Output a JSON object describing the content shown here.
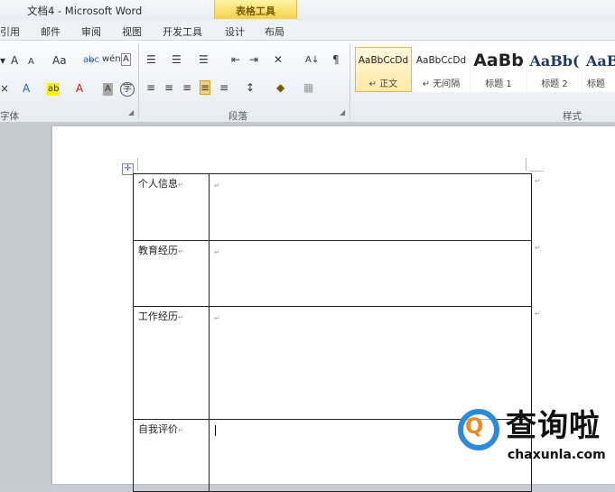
{
  "window": {
    "title": "文档4 - Microsoft Word"
  },
  "contextual_tab": {
    "label": "表格工具"
  },
  "tabs": [
    "引用",
    "邮件",
    "审阅",
    "视图",
    "开发工具",
    "设计",
    "布局"
  ],
  "ribbon": {
    "groups": {
      "font": "字体",
      "paragraph": "段落",
      "styles": "样式"
    },
    "font_tools": {
      "grow": "A",
      "shrink": "A",
      "change_case": "Aa",
      "clear_format": "ab̶c",
      "phonetic": "wén",
      "char_border": "A",
      "clear": "×",
      "text_effect": "A",
      "highlight": "ab",
      "font_color": "A",
      "char_shading": "A",
      "enclose": "字"
    },
    "paragraph_tools": {
      "bullets": "☰",
      "numbering": "☰",
      "multilevel": "☰",
      "dec_indent": "⇤",
      "inc_indent": "⇥",
      "chinese_layout": "✕",
      "sort": "A↓",
      "show_marks": "¶",
      "align_left": "≡",
      "center": "≡",
      "align_right": "≡",
      "justify": "≡",
      "distributed": "≡",
      "line_spacing": "↕",
      "shading": "◆",
      "borders": "▦"
    },
    "styles": [
      {
        "preview": "AaBbCcDd",
        "name": "↵ 正文"
      },
      {
        "preview": "AaBbCcDd",
        "name": "↵ 无间隔"
      },
      {
        "preview": "AaBb",
        "name": "标题 1"
      },
      {
        "preview": "AaBb(",
        "name": "标题 2"
      },
      {
        "preview": "AaB",
        "name": "标题"
      }
    ]
  },
  "document": {
    "rows": [
      {
        "label": "个人信息"
      },
      {
        "label": "教育经历"
      },
      {
        "label": "工作经历"
      },
      {
        "label": "自我评价"
      }
    ],
    "para_mark": "↵"
  },
  "watermark": {
    "glyph": "Q",
    "brand": "查询啦",
    "domain": "chaxunla.com"
  },
  "colors": {
    "accent": "#2a8bdc",
    "contextual": "#f3d14a"
  }
}
